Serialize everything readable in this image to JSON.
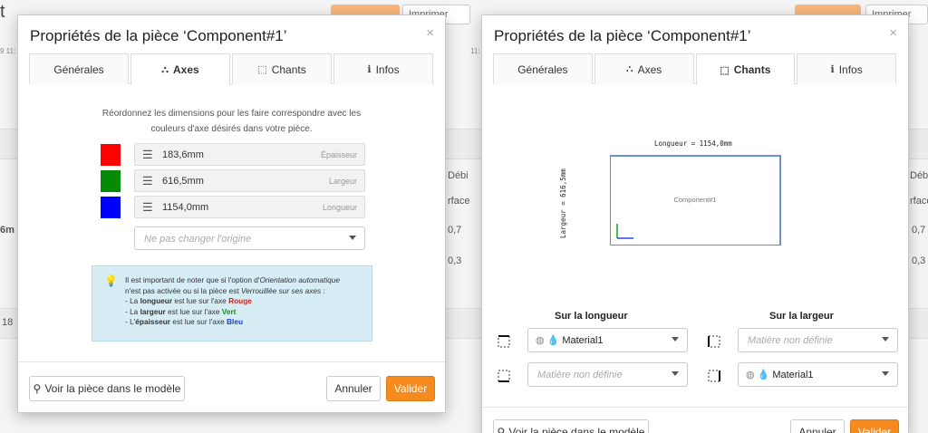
{
  "background": {
    "header_left_fragment": "t",
    "print_label": "Imprimer",
    "print_label_partial": "Imprimer",
    "time_fragment_left": "9 11:",
    "time_fragment_right": "11:",
    "col_debit": "Débi",
    "col_surface": "rface",
    "row_values": [
      "6m",
      "0,7",
      "0,3",
      "18"
    ],
    "row_values_right": [
      "0,7",
      "0,3"
    ]
  },
  "left_modal": {
    "title": "Propriétés de la pièce ‘Component#1’",
    "close": "×",
    "tabs": [
      {
        "label": "Générales",
        "icon": ""
      },
      {
        "label": "Axes",
        "icon": "⛬"
      },
      {
        "label": "Chants",
        "icon": "⬚"
      },
      {
        "label": "Infos",
        "icon": "ℹ"
      }
    ],
    "intro_line1": "Réordonnez les dimensions pour les faire correspondre avec les",
    "intro_line2": "couleurs d'axe désirés dans votre pièce.",
    "axes": [
      {
        "color": "#ff0000",
        "value": "183,6mm",
        "axis_name": "Épaisseur"
      },
      {
        "color": "#078a07",
        "value": "616,5mm",
        "axis_name": "Largeur"
      },
      {
        "color": "#0000ff",
        "value": "1154,0mm",
        "axis_name": "Longueur"
      }
    ],
    "origin_placeholder": "Ne pas changer l'origine",
    "info": {
      "l1_a": "Il est important de noter que si l'option d'",
      "l1_b": "Orientation automatique",
      "l2_a": "n'est pas activée ou si la pièce est ",
      "l2_b": "Verrouillée sur ses axes",
      "l2_c": " :",
      "l3_a": "- La ",
      "l3_b": "longueur",
      "l3_c": " est lue sur l'axe ",
      "l3_d": "Rouge",
      "l4_a": "- La ",
      "l4_b": "largeur",
      "l4_c": " est lue sur l'axe ",
      "l4_d": "Vert",
      "l5_a": "- L'",
      "l5_b": "épaisseur",
      "l5_c": " est lue sur l'axe ",
      "l5_d": "Bleu"
    },
    "view_button": "Voir la pièce dans le modèle",
    "cancel_button": "Annuler",
    "validate_button": "Valider"
  },
  "right_modal": {
    "title": "Propriétés de la pièce ‘Component#1’",
    "close": "×",
    "tabs": [
      {
        "label": "Générales",
        "icon": ""
      },
      {
        "label": "Axes",
        "icon": "⛬"
      },
      {
        "label": "Chants",
        "icon": "⬚"
      },
      {
        "label": "Infos",
        "icon": "ℹ"
      }
    ],
    "length_caption": "Longueur = 1154,0mm",
    "width_caption": "Largeur = 616,5mm",
    "component_name": "Component#1",
    "section_length": "Sur la longueur",
    "section_width": "Sur la largeur",
    "edge_top_left": "Material1",
    "edge_bottom_left_placeholder": "Matière non définie",
    "edge_top_right_placeholder": "Matière non définie",
    "edge_bottom_right": "Material1",
    "view_button": "Voir la pièce dans le modèle",
    "cancel_button": "Annuler",
    "validate_button": "Valider"
  }
}
